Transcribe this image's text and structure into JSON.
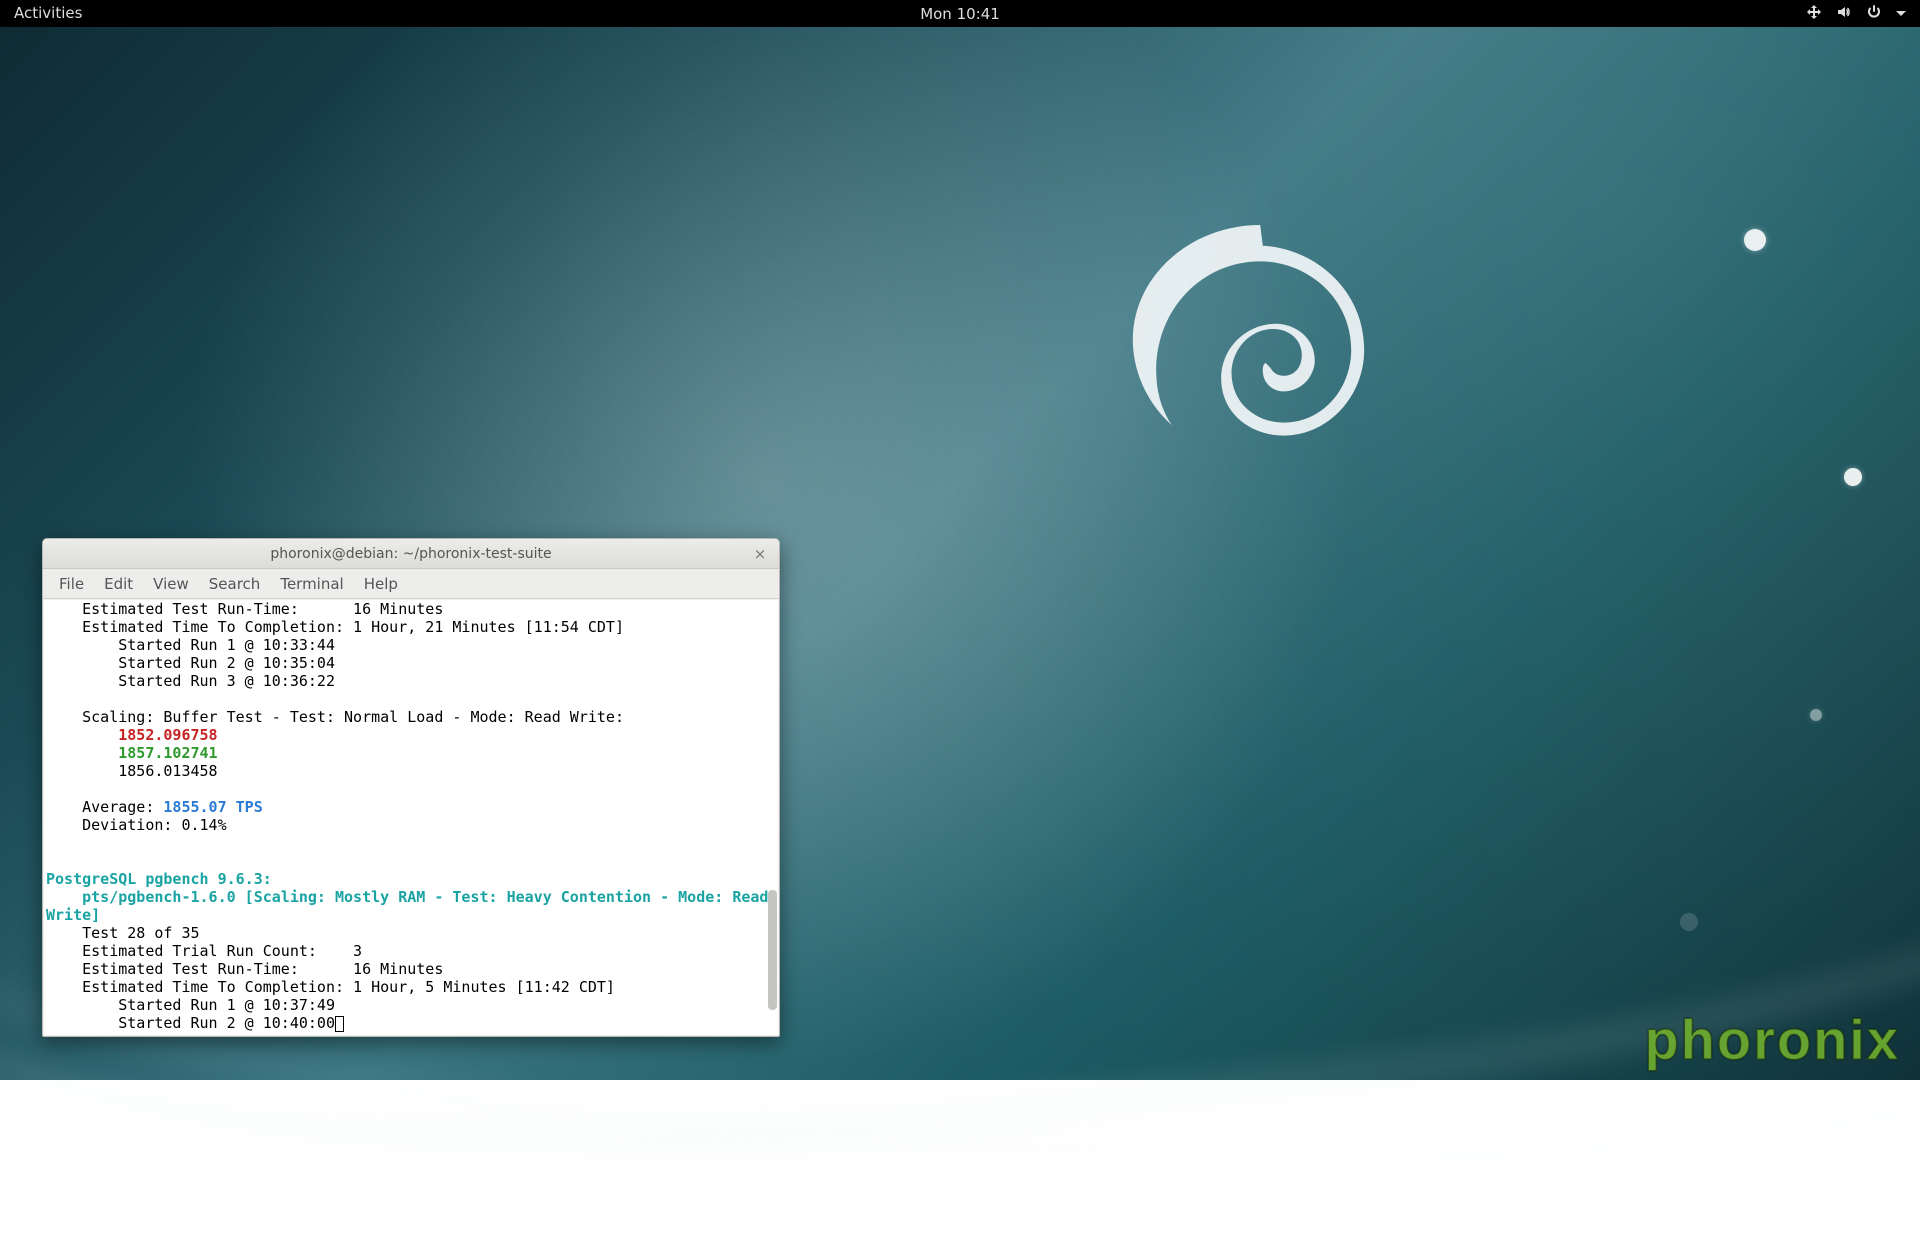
{
  "panel": {
    "activities": "Activities",
    "clock": "Mon 10:41"
  },
  "watermark": "phoronix",
  "window": {
    "title": "phoronix@debian: ~/phoronix-test-suite",
    "close_glyph": "×",
    "menus": [
      "File",
      "Edit",
      "View",
      "Search",
      "Terminal",
      "Help"
    ]
  },
  "term": {
    "l01": "    Estimated Test Run-Time:      16 Minutes",
    "l02": "    Estimated Time To Completion: 1 Hour, 21 Minutes [11:54 CDT]",
    "l03": "        Started Run 1 @ 10:33:44",
    "l04": "        Started Run 2 @ 10:35:04",
    "l05": "        Started Run 3 @ 10:36:22",
    "blank": "",
    "l06": "    Scaling: Buffer Test - Test: Normal Load - Mode: Read Write:",
    "l07a": "        ",
    "l07b": "1852.096758",
    "l08a": "        ",
    "l08b": "1857.102741",
    "l09": "        1856.013458",
    "l10a": "    Average: ",
    "l10b": "1855.07 TPS",
    "l11": "    Deviation: 0.14%",
    "l12": "PostgreSQL pgbench 9.6.3:",
    "l13a": "    ",
    "l13b": "pts/pgbench-1.6.0 [Scaling: Mostly RAM - Test: Heavy Contention - Mode: Read ",
    "l13c": "Write]",
    "l14": "    Test 28 of 35",
    "l15": "    Estimated Trial Run Count:    3",
    "l16": "    Estimated Test Run-Time:      16 Minutes",
    "l17": "    Estimated Time To Completion: 1 Hour, 5 Minutes [11:42 CDT]",
    "l18": "        Started Run 1 @ 10:37:49",
    "l19": "        Started Run 2 @ 10:40:00"
  }
}
